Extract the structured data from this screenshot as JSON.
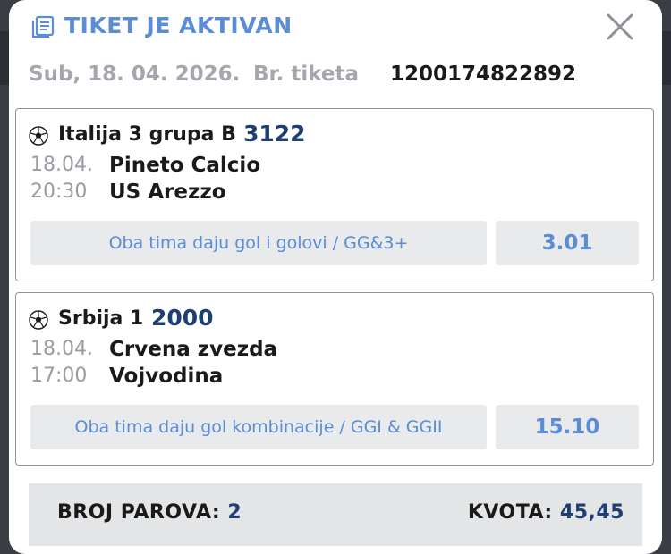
{
  "header": {
    "title": "TIKET JE AKTIVAN",
    "icon": "ticket-list-icon",
    "close_icon": "close-icon"
  },
  "meta": {
    "date": "Sub, 18. 04. 2026.",
    "ticket_label": "Br. tiketa",
    "ticket_number": "1200174822892"
  },
  "matches": [
    {
      "league": "Italija 3 grupa B",
      "code": "3122",
      "date": "18.04.",
      "time": "20:30",
      "home": "Pineto Calcio",
      "away": "US Arezzo",
      "bet": "Oba tima daju gol i golovi / GG&3+",
      "odds": "3.01"
    },
    {
      "league": "Srbija 1",
      "code": "2000",
      "date": "18.04.",
      "time": "17:00",
      "home": "Crvena zvezda",
      "away": "Vojvodina",
      "bet": "Oba tima daju gol kombinacije / GGI & GGII",
      "odds": "15.10"
    }
  ],
  "summary": {
    "pairs_label": "BROJ PAROVA:",
    "pairs_value": "2",
    "odds_label": "KVOTA:",
    "odds_value": "45,45"
  },
  "colors": {
    "accent_blue": "#5b8dd6",
    "dark_navy": "#1d3f73",
    "muted_gray": "#a4a7ad",
    "button_bg": "#e9eaec"
  }
}
